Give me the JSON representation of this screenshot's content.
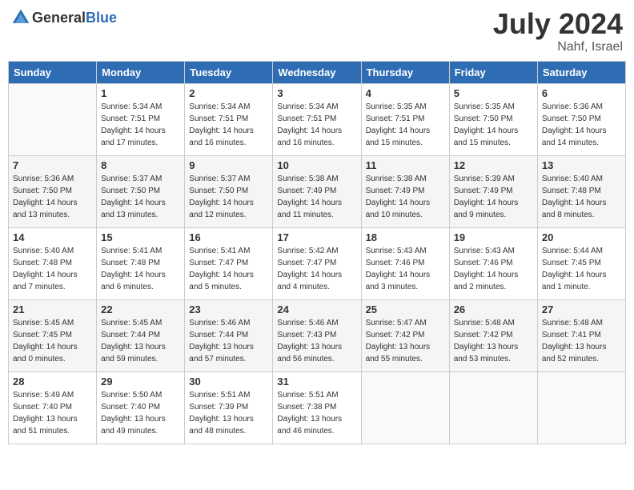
{
  "header": {
    "logo_general": "General",
    "logo_blue": "Blue",
    "month": "July 2024",
    "location": "Nahf, Israel"
  },
  "weekdays": [
    "Sunday",
    "Monday",
    "Tuesday",
    "Wednesday",
    "Thursday",
    "Friday",
    "Saturday"
  ],
  "weeks": [
    [
      {
        "day": null,
        "info": null
      },
      {
        "day": "1",
        "sunrise": "5:34 AM",
        "sunset": "7:51 PM",
        "daylight": "14 hours and 17 minutes."
      },
      {
        "day": "2",
        "sunrise": "5:34 AM",
        "sunset": "7:51 PM",
        "daylight": "14 hours and 16 minutes."
      },
      {
        "day": "3",
        "sunrise": "5:34 AM",
        "sunset": "7:51 PM",
        "daylight": "14 hours and 16 minutes."
      },
      {
        "day": "4",
        "sunrise": "5:35 AM",
        "sunset": "7:51 PM",
        "daylight": "14 hours and 15 minutes."
      },
      {
        "day": "5",
        "sunrise": "5:35 AM",
        "sunset": "7:50 PM",
        "daylight": "14 hours and 15 minutes."
      },
      {
        "day": "6",
        "sunrise": "5:36 AM",
        "sunset": "7:50 PM",
        "daylight": "14 hours and 14 minutes."
      }
    ],
    [
      {
        "day": "7",
        "sunrise": "5:36 AM",
        "sunset": "7:50 PM",
        "daylight": "14 hours and 13 minutes."
      },
      {
        "day": "8",
        "sunrise": "5:37 AM",
        "sunset": "7:50 PM",
        "daylight": "14 hours and 13 minutes."
      },
      {
        "day": "9",
        "sunrise": "5:37 AM",
        "sunset": "7:50 PM",
        "daylight": "14 hours and 12 minutes."
      },
      {
        "day": "10",
        "sunrise": "5:38 AM",
        "sunset": "7:49 PM",
        "daylight": "14 hours and 11 minutes."
      },
      {
        "day": "11",
        "sunrise": "5:38 AM",
        "sunset": "7:49 PM",
        "daylight": "14 hours and 10 minutes."
      },
      {
        "day": "12",
        "sunrise": "5:39 AM",
        "sunset": "7:49 PM",
        "daylight": "14 hours and 9 minutes."
      },
      {
        "day": "13",
        "sunrise": "5:40 AM",
        "sunset": "7:48 PM",
        "daylight": "14 hours and 8 minutes."
      }
    ],
    [
      {
        "day": "14",
        "sunrise": "5:40 AM",
        "sunset": "7:48 PM",
        "daylight": "14 hours and 7 minutes."
      },
      {
        "day": "15",
        "sunrise": "5:41 AM",
        "sunset": "7:48 PM",
        "daylight": "14 hours and 6 minutes."
      },
      {
        "day": "16",
        "sunrise": "5:41 AM",
        "sunset": "7:47 PM",
        "daylight": "14 hours and 5 minutes."
      },
      {
        "day": "17",
        "sunrise": "5:42 AM",
        "sunset": "7:47 PM",
        "daylight": "14 hours and 4 minutes."
      },
      {
        "day": "18",
        "sunrise": "5:43 AM",
        "sunset": "7:46 PM",
        "daylight": "14 hours and 3 minutes."
      },
      {
        "day": "19",
        "sunrise": "5:43 AM",
        "sunset": "7:46 PM",
        "daylight": "14 hours and 2 minutes."
      },
      {
        "day": "20",
        "sunrise": "5:44 AM",
        "sunset": "7:45 PM",
        "daylight": "14 hours and 1 minute."
      }
    ],
    [
      {
        "day": "21",
        "sunrise": "5:45 AM",
        "sunset": "7:45 PM",
        "daylight": "14 hours and 0 minutes."
      },
      {
        "day": "22",
        "sunrise": "5:45 AM",
        "sunset": "7:44 PM",
        "daylight": "13 hours and 59 minutes."
      },
      {
        "day": "23",
        "sunrise": "5:46 AM",
        "sunset": "7:44 PM",
        "daylight": "13 hours and 57 minutes."
      },
      {
        "day": "24",
        "sunrise": "5:46 AM",
        "sunset": "7:43 PM",
        "daylight": "13 hours and 56 minutes."
      },
      {
        "day": "25",
        "sunrise": "5:47 AM",
        "sunset": "7:42 PM",
        "daylight": "13 hours and 55 minutes."
      },
      {
        "day": "26",
        "sunrise": "5:48 AM",
        "sunset": "7:42 PM",
        "daylight": "13 hours and 53 minutes."
      },
      {
        "day": "27",
        "sunrise": "5:48 AM",
        "sunset": "7:41 PM",
        "daylight": "13 hours and 52 minutes."
      }
    ],
    [
      {
        "day": "28",
        "sunrise": "5:49 AM",
        "sunset": "7:40 PM",
        "daylight": "13 hours and 51 minutes."
      },
      {
        "day": "29",
        "sunrise": "5:50 AM",
        "sunset": "7:40 PM",
        "daylight": "13 hours and 49 minutes."
      },
      {
        "day": "30",
        "sunrise": "5:51 AM",
        "sunset": "7:39 PM",
        "daylight": "13 hours and 48 minutes."
      },
      {
        "day": "31",
        "sunrise": "5:51 AM",
        "sunset": "7:38 PM",
        "daylight": "13 hours and 46 minutes."
      },
      {
        "day": null,
        "info": null
      },
      {
        "day": null,
        "info": null
      },
      {
        "day": null,
        "info": null
      }
    ]
  ]
}
